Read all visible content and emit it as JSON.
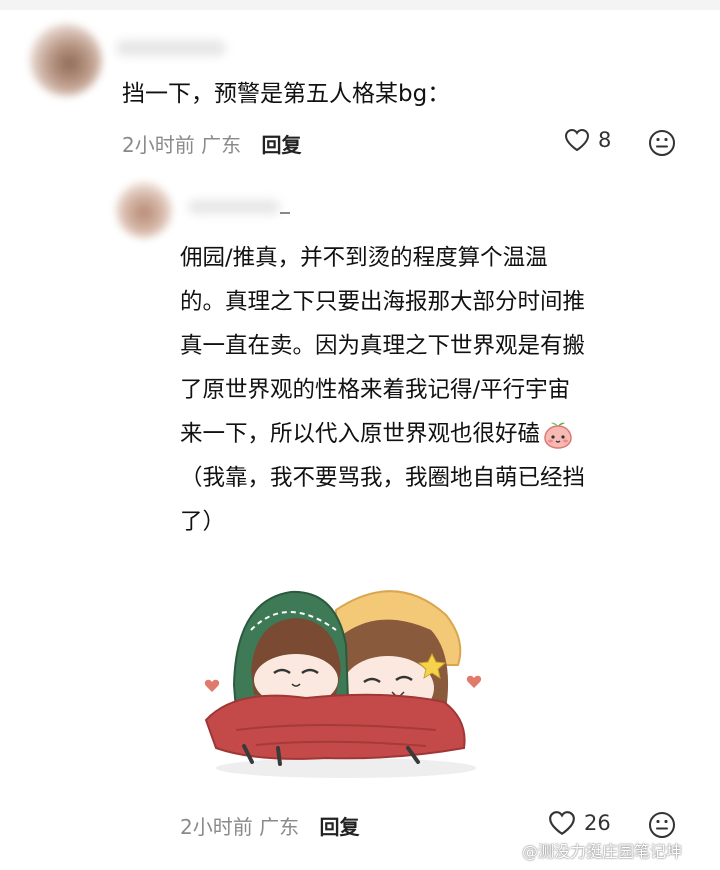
{
  "comment1": {
    "text": "挡一下，预警是第五人格某bg：",
    "time": "2小时前",
    "location": "广东",
    "reply_label": "回复",
    "likes": "8"
  },
  "comment2": {
    "lines": [
      "佣园/推真，并不到烫的程度算个温温",
      "的。真理之下只要出海报那大部分时间推",
      "真一直在卖。因为真理之下世界观是有搬",
      "了原世界观的性格来着我记得/平行宇宙",
      "来一下，所以代入原世界观也很好磕",
      "（我靠，我不要骂我，我圈地自萌已经挡",
      "了）"
    ],
    "time": "2小时前",
    "location": "广东",
    "reply_label": "回复",
    "likes": "26"
  },
  "watermark": "@测没力挺庄园笔记坤",
  "icons": {
    "like": "heart-outline-icon",
    "emoji": "smiley-icon",
    "inline_emoji": "peach-face-icon",
    "watermark_logo": "weibo-logo-icon"
  },
  "colors": {
    "meta_gray": "#8a8a8a",
    "scarf_red": "#c44a4a",
    "hat_green": "#3e7a56",
    "hat_yellow": "#f0c070"
  }
}
